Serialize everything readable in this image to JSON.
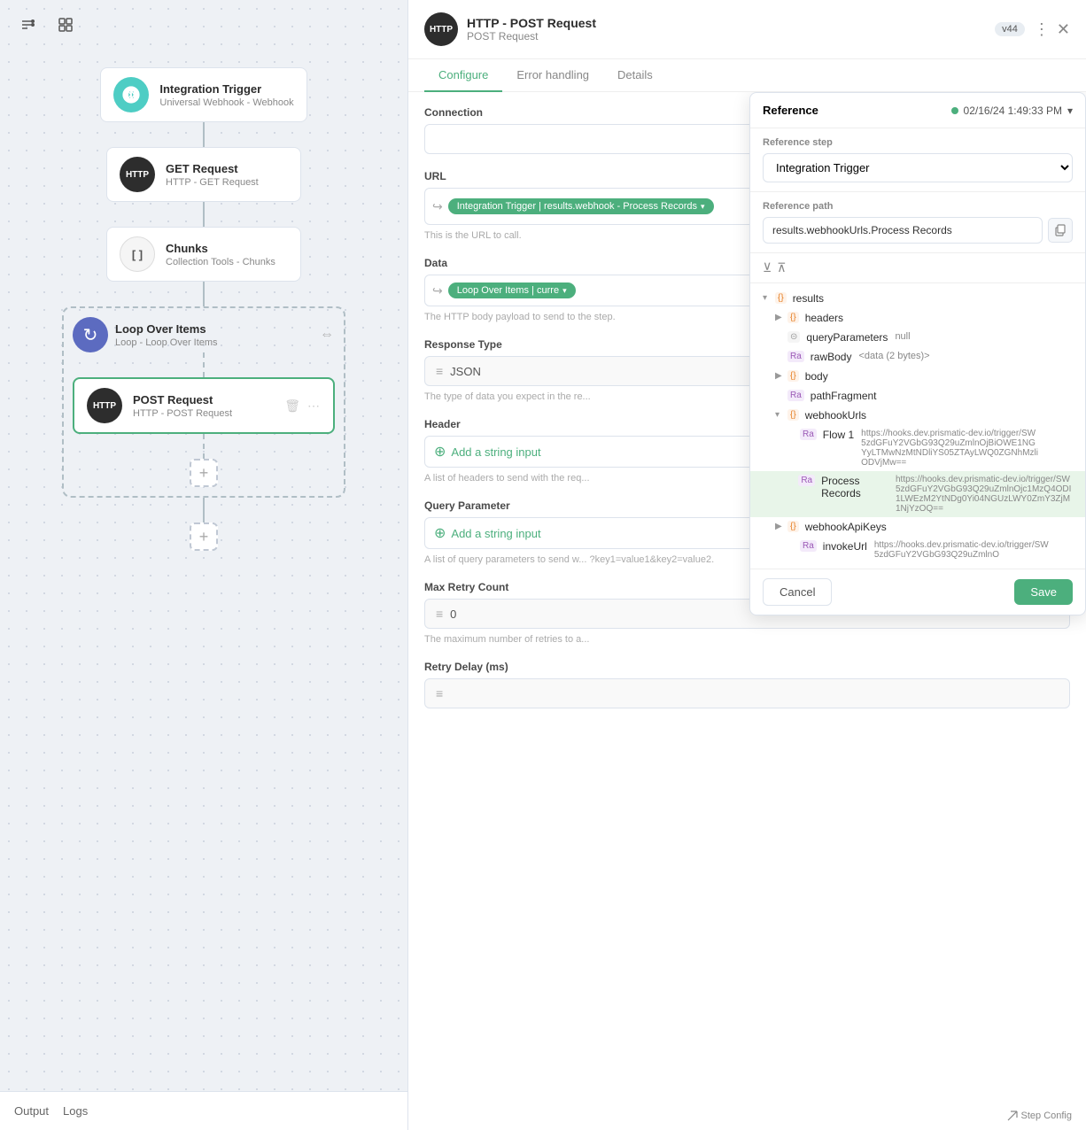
{
  "canvas": {
    "nodes": [
      {
        "id": "integration-trigger",
        "title": "Integration Trigger",
        "subtitle": "Universal Webhook - Webhook",
        "icon_type": "teal",
        "icon_text": "🔗"
      },
      {
        "id": "get-request",
        "title": "GET Request",
        "subtitle": "HTTP - GET Request",
        "icon_type": "dark",
        "icon_text": "HTTP"
      },
      {
        "id": "chunks",
        "title": "Chunks",
        "subtitle": "Collection Tools - Chunks",
        "icon_type": "gray",
        "icon_text": "[ ]"
      },
      {
        "id": "loop-over-items",
        "title": "Loop Over Items",
        "subtitle": "Loop - Loop Over Items",
        "icon_type": "blue-purple",
        "icon_text": "↻"
      },
      {
        "id": "post-request",
        "title": "POST Request",
        "subtitle": "HTTP - POST Request",
        "icon_type": "dark",
        "icon_text": "HTTP",
        "active": true
      }
    ],
    "bottom_tabs": [
      "Output",
      "Logs"
    ]
  },
  "panel": {
    "icon_text": "HTTP",
    "title": "HTTP - POST Request",
    "subtitle": "POST Request",
    "version": "v44",
    "tabs": [
      "Configure",
      "Error handling",
      "Details"
    ],
    "active_tab": "Configure",
    "sections": {
      "connection": {
        "label": "Connection",
        "placeholder": ""
      },
      "url": {
        "label": "URL",
        "token_label": "Integration Trigger | results.webhook - Process Records",
        "hint": "This is the URL to call."
      },
      "data": {
        "label": "Data",
        "token_label": "Loop Over Items | curre",
        "hint": "The HTTP body payload to send to the step."
      },
      "response_type": {
        "label": "Response Type",
        "value": "JSON",
        "hint": "The type of data you expect in the re..."
      },
      "header": {
        "label": "Header",
        "add_label": "Add a string input",
        "hint": "A list of headers to send with the req..."
      },
      "query_parameter": {
        "label": "Query Parameter",
        "add_label": "Add a string input",
        "hint": "A list of query parameters to send w... ?key1=value1&key2=value2."
      },
      "max_retry": {
        "label": "Max Retry Count",
        "value": "0",
        "hint": "The maximum number of retries to a..."
      },
      "retry_delay": {
        "label": "Retry Delay (ms)"
      }
    }
  },
  "reference_popup": {
    "title": "Reference",
    "timestamp": "02/16/24 1:49:33 PM",
    "reference_step_label": "Reference step",
    "reference_step_value": "Integration Trigger",
    "reference_path_label": "Reference path",
    "reference_path_value": "results.webhookUrls.Process Records",
    "tree": [
      {
        "level": 0,
        "type": "obj",
        "key": "results",
        "value": "",
        "expanded": true
      },
      {
        "level": 1,
        "type": "obj",
        "key": "headers",
        "value": "",
        "expanded": false
      },
      {
        "level": 1,
        "type": "obj",
        "key": "queryParameters",
        "value": "null",
        "expanded": false,
        "icon": "query"
      },
      {
        "level": 1,
        "type": "ra",
        "key": "rawBody",
        "value": "<data (2 bytes)>"
      },
      {
        "level": 1,
        "type": "obj",
        "key": "body",
        "value": "",
        "expanded": false
      },
      {
        "level": 1,
        "type": "ra",
        "key": "pathFragment",
        "value": ""
      },
      {
        "level": 1,
        "type": "obj",
        "key": "webhookUrls",
        "value": "",
        "expanded": true
      },
      {
        "level": 2,
        "type": "ra",
        "key": "Flow 1",
        "value": "https://hooks.dev.prismatic-dev.io/trigger/SW5zdGFuY2VGbG93Q29uZmlnOjBiOWE1NGYyLTMwNzMtNDliYS05ZTAyLWQ0ZGNhMzliODVjMw=="
      },
      {
        "level": 2,
        "type": "ra",
        "key": "Process Records",
        "value": "https://hooks.dev.prismatic-dev.io/trigger/SW5zdGFuY2VGbG93Q29uZm lnOjc1MzQ4ODI1LWEzM2YtNDg0Yi04NGUzLWY0ZmY3ZjM1NjYzOQ==",
        "selected": true
      },
      {
        "level": 1,
        "type": "obj",
        "key": "webhookApiKeys",
        "value": "",
        "expanded": false
      },
      {
        "level": 2,
        "type": "ra",
        "key": "invokeUrl",
        "value": "https://hooks.dev.prismatic-dev.io/trigger/SW5zdGFuY2VGbG93Q29uZm lnO"
      }
    ],
    "cancel_label": "Cancel",
    "save_label": "Save"
  }
}
